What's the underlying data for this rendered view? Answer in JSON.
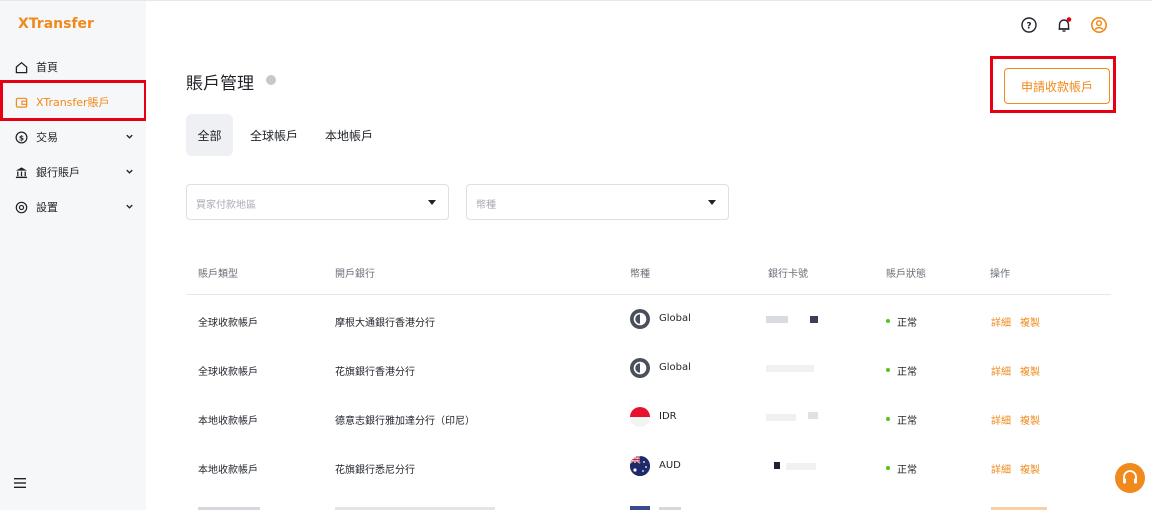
{
  "brand": {
    "logo": "XTransfer"
  },
  "sidebar": {
    "items": [
      {
        "label": "首頁",
        "icon": "home-icon"
      },
      {
        "label": "XTransfer賬戶",
        "icon": "wallet-icon",
        "active": true
      },
      {
        "label": "交易",
        "icon": "dollar-circle-icon",
        "has_children": true
      },
      {
        "label": "銀行賬戶",
        "icon": "bank-icon",
        "has_children": true
      },
      {
        "label": "設置",
        "icon": "settings-icon",
        "has_children": true
      }
    ]
  },
  "topbar": {
    "icons": [
      "help-icon",
      "notification-icon",
      "user-icon"
    ]
  },
  "page": {
    "title": "賬戶管理",
    "apply_button": "申請收款帳戶",
    "tabs": [
      "全部",
      "全球帳戶",
      "本地帳戶"
    ],
    "filters": {
      "region_placeholder": "買家付款地區",
      "currency_placeholder": "幣種"
    }
  },
  "table": {
    "headers": [
      "賬戶類型",
      "開戶銀行",
      "幣種",
      "銀行卡號",
      "賬戶狀態",
      "操作"
    ],
    "rows": [
      {
        "type": "全球收款帳戶",
        "bank": "摩根大通銀行香港分行",
        "currency": "Global",
        "currency_icon": "global-currency-icon",
        "status": "正常",
        "details": "詳細",
        "copy": "複製"
      },
      {
        "type": "全球收款帳戶",
        "bank": "花旗銀行香港分行",
        "currency": "Global",
        "currency_icon": "global-currency-icon",
        "status": "正常",
        "details": "詳細",
        "copy": "複製"
      },
      {
        "type": "本地收款帳戶",
        "bank": "德意志銀行雅加達分行（印尼）",
        "currency": "IDR",
        "currency_icon": "indonesia-flag-icon",
        "status": "正常",
        "details": "詳細",
        "copy": "複製"
      },
      {
        "type": "本地收款帳戶",
        "bank": "花旗銀行悉尼分行",
        "currency": "AUD",
        "currency_icon": "australia-flag-icon",
        "status": "正常",
        "details": "詳細",
        "copy": "複製"
      }
    ]
  },
  "colors": {
    "accent": "#f08a1c",
    "highlight": "#e60012",
    "status_ok": "#52c41a"
  }
}
